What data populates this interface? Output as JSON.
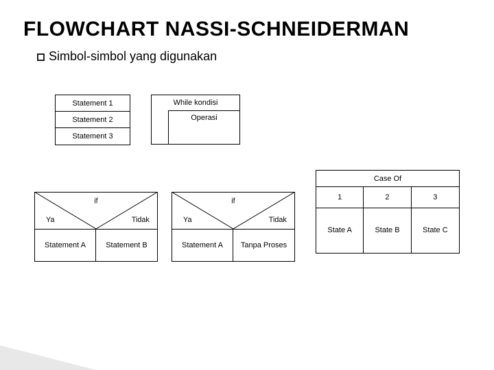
{
  "title": "FLOWCHART NASSI-SCHNEIDERMAN",
  "subtitle": "Simbol-simbol yang digunakan",
  "sequence": {
    "s1": "Statement 1",
    "s2": "Statement 2",
    "s3": "Statement 3"
  },
  "while": {
    "cond": "While kondisi",
    "body": "Operasi"
  },
  "case": {
    "head": "Case Of",
    "c1": {
      "key": "1",
      "val": "State A"
    },
    "c2": {
      "key": "2",
      "val": "State B"
    },
    "c3": {
      "key": "3",
      "val": "State C"
    }
  },
  "if1": {
    "cond": "if",
    "yes": "Ya",
    "no": "Tidak",
    "left": "Statement A",
    "right": "Statement B"
  },
  "if2": {
    "cond": "if",
    "yes": "Ya",
    "no": "Tidak",
    "left": "Statement A",
    "right": "Tanpa Proses"
  },
  "chart_data": {
    "type": "table",
    "title": "Nassi-Schneiderman diagram symbols",
    "symbols": [
      {
        "construct": "sequence",
        "cells": [
          "Statement 1",
          "Statement 2",
          "Statement 3"
        ]
      },
      {
        "construct": "while",
        "condition": "While kondisi",
        "body": "Operasi"
      },
      {
        "construct": "if",
        "condition": "if",
        "branches": [
          {
            "label": "Ya",
            "body": "Statement A"
          },
          {
            "label": "Tidak",
            "body": "Statement B"
          }
        ]
      },
      {
        "construct": "if",
        "condition": "if",
        "branches": [
          {
            "label": "Ya",
            "body": "Statement A"
          },
          {
            "label": "Tidak",
            "body": "Tanpa Proses"
          }
        ]
      },
      {
        "construct": "case",
        "expression": "Case Of",
        "branches": [
          {
            "label": "1",
            "body": "State A"
          },
          {
            "label": "2",
            "body": "State B"
          },
          {
            "label": "3",
            "body": "State C"
          }
        ]
      }
    ]
  }
}
